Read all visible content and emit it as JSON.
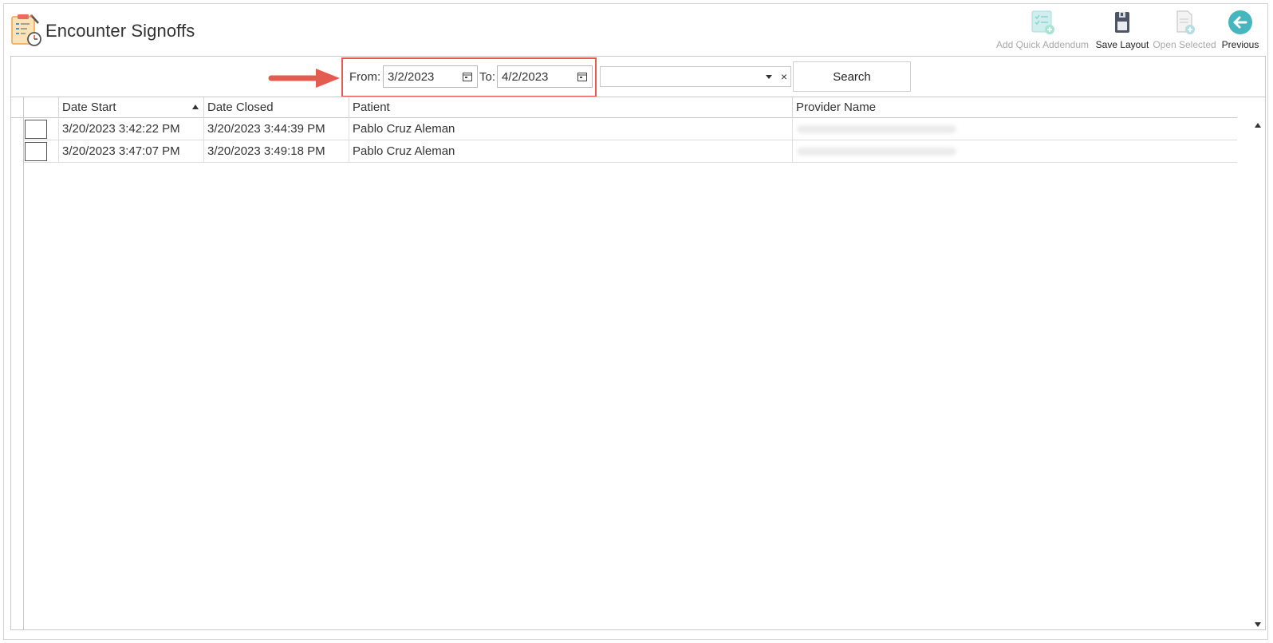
{
  "header": {
    "title": "Encounter Signoffs",
    "icon": "clipboard-clock-icon"
  },
  "toolbar": {
    "add_quick_addendum": {
      "label": "Add Quick Addendum",
      "icon": "checklist-add-icon",
      "enabled": false
    },
    "save_layout": {
      "label": "Save Layout",
      "icon": "floppy-disk-icon",
      "enabled": true
    },
    "open_selected": {
      "label": "Open Selected",
      "icon": "document-add-icon",
      "enabled": false
    },
    "previous": {
      "label": "Previous",
      "icon": "arrow-left-circle-icon",
      "enabled": true
    }
  },
  "filter": {
    "from_label": "From:",
    "from_value": "3/2/2023",
    "to_label": "To:",
    "to_value": "4/2/2023",
    "combo_value": "",
    "clear_glyph": "×",
    "search_label": "Search",
    "highlight_color": "#e45b4f"
  },
  "grid": {
    "columns": [
      "Date Start",
      "Date Closed",
      "Patient",
      "Provider Name"
    ],
    "sorted_column": "Date Start",
    "sort_direction": "ascending",
    "rows": [
      {
        "date_start": "3/20/2023 3:42:22 PM",
        "date_closed": "3/20/2023 3:44:39 PM",
        "patient": "Pablo Cruz Aleman",
        "provider": ""
      },
      {
        "date_start": "3/20/2023 3:47:07 PM",
        "date_closed": "3/20/2023 3:49:18 PM",
        "patient": "Pablo Cruz Aleman",
        "provider": ""
      }
    ]
  },
  "colors": {
    "accent_teal": "#45b6bd",
    "annotation_red": "#e45b4f"
  }
}
